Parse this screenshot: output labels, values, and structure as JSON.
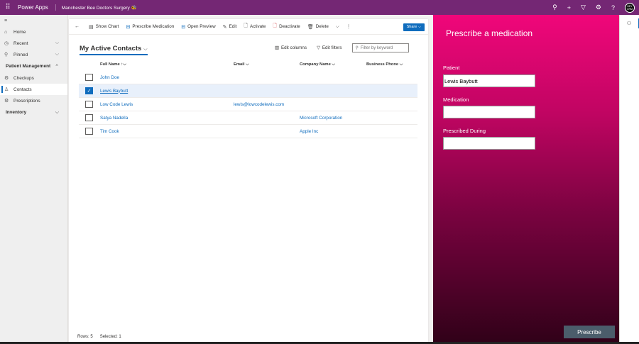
{
  "topbar": {
    "app_name": "Power Apps",
    "env_name": "Manchester Bee Doctors Surgery 🐝",
    "avatar_text": "HEY CRM"
  },
  "nav": {
    "items": [
      {
        "icon": "≡",
        "label": ""
      },
      {
        "icon": "⌂",
        "label": "Home"
      },
      {
        "icon": "◷",
        "label": "Recent",
        "chev": "⌵"
      },
      {
        "icon": "⚲",
        "label": "Pinned",
        "chev": "⌵"
      }
    ],
    "group1": {
      "label": "Patient Management",
      "chev": "⌃"
    },
    "group1_items": [
      {
        "icon": "⚙",
        "label": "Checkups"
      },
      {
        "icon": "♙",
        "label": "Contacts"
      },
      {
        "icon": "⚙",
        "label": "Prescriptions"
      }
    ],
    "group2": {
      "label": "Inventory",
      "chev": "⌵"
    }
  },
  "cmdbar": {
    "back": "←",
    "show_chart": "Show Chart",
    "prescribe": "Prescribe Medication",
    "open_preview": "Open Preview",
    "edit": "Edit",
    "activate": "Activate",
    "deactivate": "Deactivate",
    "delete": "Delete",
    "more": "⋮",
    "dropdown": "⌵",
    "share": "Share ⌵"
  },
  "view": {
    "title": "My Active Contacts",
    "edit_columns": "Edit columns",
    "edit_filters": "Edit filters",
    "filter_placeholder": "Filter by keyword"
  },
  "grid": {
    "columns": {
      "name": "Full Name ↑⌵",
      "email": "Email ⌵",
      "company": "Company Name ⌵",
      "phone": "Business Phone ⌵"
    },
    "rows": [
      {
        "name": "John Doe",
        "email": "",
        "company": "",
        "phone": ""
      },
      {
        "name": "Lewis Baybutt",
        "email": "",
        "company": "",
        "phone": ""
      },
      {
        "name": "Low Code Lewis",
        "email": "lewis@lowcodelewis.com",
        "company": "",
        "phone": ""
      },
      {
        "name": "Satya Nadella",
        "email": "",
        "company": "Microsoft Corporation",
        "phone": ""
      },
      {
        "name": "Tim Cook",
        "email": "",
        "company": "Apple Inc",
        "phone": ""
      }
    ]
  },
  "footer": {
    "rows": "Rows: 5",
    "selected": "Selected: 1"
  },
  "panel": {
    "title": "Prescribe a medication",
    "patient_label": "Patient",
    "patient_value": "Lewis Baybutt",
    "medication_label": "Medication",
    "medication_value": "",
    "prescribed_label": "Prescribed During",
    "prescribed_value": "",
    "button": "Prescribe"
  }
}
